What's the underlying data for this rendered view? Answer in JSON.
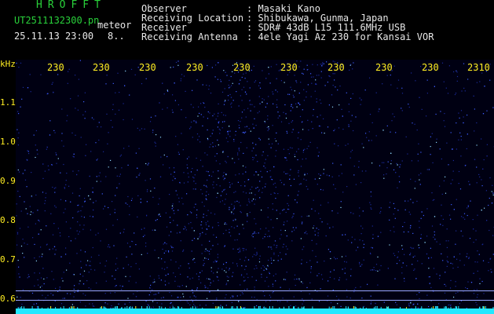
{
  "header": {
    "app_title": "HROFFT",
    "file_name": "UT2511132300.pn",
    "meteor_label": "meteor",
    "date_time": "25.11.13 23:00",
    "count_value": "8..",
    "info": [
      {
        "key": "Observer",
        "value": ": Masaki Kano"
      },
      {
        "key": "Receiving Location",
        "value": ": Shibukawa, Gunma, Japan"
      },
      {
        "key": "Receiver",
        "value": ": SDR# 43dB L15 111.6MHz USB"
      },
      {
        "key": "Receiving Antenna",
        "value": ": 4ele Yagi Az 230 for Kansai VOR"
      }
    ]
  },
  "plot": {
    "y_unit": "kHz",
    "y_ticks": [
      "1.1",
      "1.0",
      "0.9",
      "0.8",
      "0.7",
      "0.6"
    ],
    "x_ticks": [
      "230",
      "230",
      "230",
      "230",
      "230",
      "230",
      "230",
      "230",
      "230",
      "2310"
    ],
    "colors": {
      "label": "#ffee22",
      "background": "#000010",
      "signal": "#2f4fff",
      "noise_floor": "#22e8ff",
      "reference_line": "#9aa8ff"
    }
  }
}
